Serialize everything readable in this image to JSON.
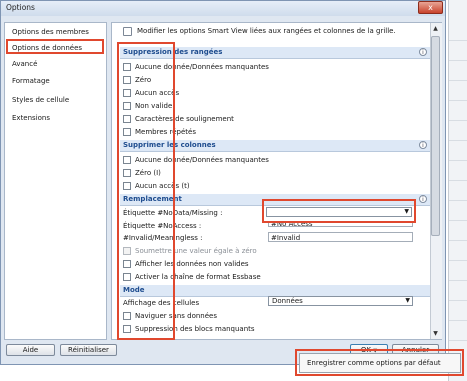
{
  "window": {
    "title": "Options",
    "close_label": "x"
  },
  "nav": {
    "items": [
      {
        "label": "Options des membres",
        "selected": false
      },
      {
        "label": "Options de données",
        "selected": true
      },
      {
        "label": "Avancé",
        "selected": false
      },
      {
        "label": "Formatage",
        "selected": false
      },
      {
        "label": "Styles de cellule",
        "selected": false
      },
      {
        "label": "Extensions",
        "selected": false
      }
    ]
  },
  "info_text": "Modifier les options Smart View liées aux rangées et colonnes de la grille.",
  "sections": {
    "suppression_rangees": {
      "title": "Suppression des rangées",
      "items": [
        {
          "label": "Aucune donnée/Données manquantes"
        },
        {
          "label": "Zéro"
        },
        {
          "label": "Aucun accès"
        },
        {
          "label": "Non valide"
        },
        {
          "label": "Caractères de soulignement"
        },
        {
          "label": "Membres répétés"
        }
      ]
    },
    "supprimer_colonnes": {
      "title": "Supprimer les colonnes",
      "items": [
        {
          "label": "Aucune donnée/Données manquantes"
        },
        {
          "label": "Zéro (I)"
        },
        {
          "label": "Aucun accès (t)"
        }
      ]
    },
    "remplacement": {
      "title": "Remplacement",
      "fields": [
        {
          "label": "Étiquette #NoData/Missing :",
          "value": ""
        },
        {
          "label": "Étiquette #NoAccess :",
          "value": "#No Access"
        },
        {
          "label": "#Invalid/Meaningless :",
          "value": "#Invalid"
        }
      ],
      "checks": [
        {
          "label": "Soumettre une valeur égale à zéro",
          "disabled": true
        },
        {
          "label": "Afficher les données non valides",
          "disabled": false
        },
        {
          "label": "Activer la chaîne de format Essbase",
          "disabled": false
        }
      ]
    },
    "mode": {
      "title": "Mode",
      "display_label": "Affichage des cellules",
      "display_value": "Données",
      "checks": [
        {
          "label": "Naviguer sans données"
        },
        {
          "label": "Suppression des blocs manquants"
        }
      ]
    }
  },
  "buttons": {
    "help": "Aide",
    "reset": "Réinitialiser",
    "ok": "OK",
    "cancel": "Annuler"
  },
  "popup": {
    "label": "Enregistrer comme options par défaut"
  },
  "colors": {
    "highlight": "#e0482e",
    "section_title": "#1f4d8f",
    "nav_selected_bg": "#cfe3fb"
  }
}
